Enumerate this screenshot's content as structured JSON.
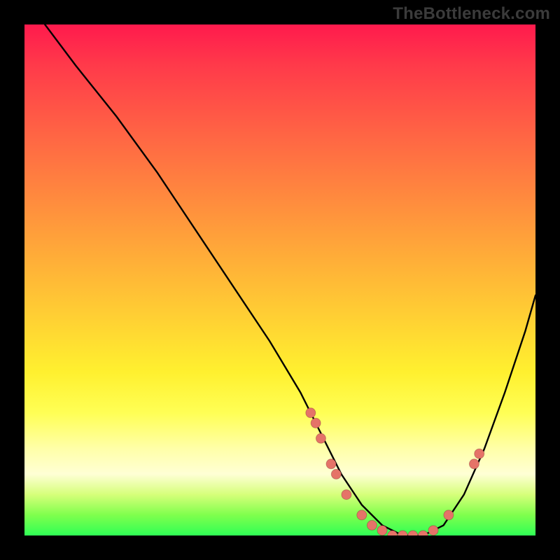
{
  "watermark": "TheBottleneck.com",
  "chart_data": {
    "type": "line",
    "title": "",
    "xlabel": "",
    "ylabel": "",
    "xlim": [
      0,
      100
    ],
    "ylim": [
      0,
      100
    ],
    "grid": false,
    "legend": false,
    "curve": {
      "name": "bottleneck-curve",
      "x": [
        4,
        10,
        18,
        26,
        34,
        42,
        48,
        54,
        58,
        62,
        66,
        70,
        74,
        78,
        82,
        86,
        90,
        94,
        98,
        100
      ],
      "y": [
        100,
        92,
        82,
        71,
        59,
        47,
        38,
        28,
        20,
        12,
        6,
        2,
        0,
        0,
        2,
        8,
        17,
        28,
        40,
        47
      ]
    },
    "points": {
      "name": "highlighted-points",
      "color": "#e57368",
      "x": [
        56,
        57,
        58,
        60,
        61,
        63,
        66,
        68,
        70,
        72,
        74,
        76,
        78,
        80,
        83,
        88,
        89
      ],
      "y": [
        24,
        22,
        19,
        14,
        12,
        8,
        4,
        2,
        1,
        0,
        0,
        0,
        0,
        1,
        4,
        14,
        16
      ]
    },
    "gradient_stops": [
      {
        "pos": 0.0,
        "color": "#ff1a4d"
      },
      {
        "pos": 0.34,
        "color": "#ff8a3e"
      },
      {
        "pos": 0.68,
        "color": "#fff02f"
      },
      {
        "pos": 0.88,
        "color": "#ffffd5"
      },
      {
        "pos": 1.0,
        "color": "#2fff55"
      }
    ]
  }
}
